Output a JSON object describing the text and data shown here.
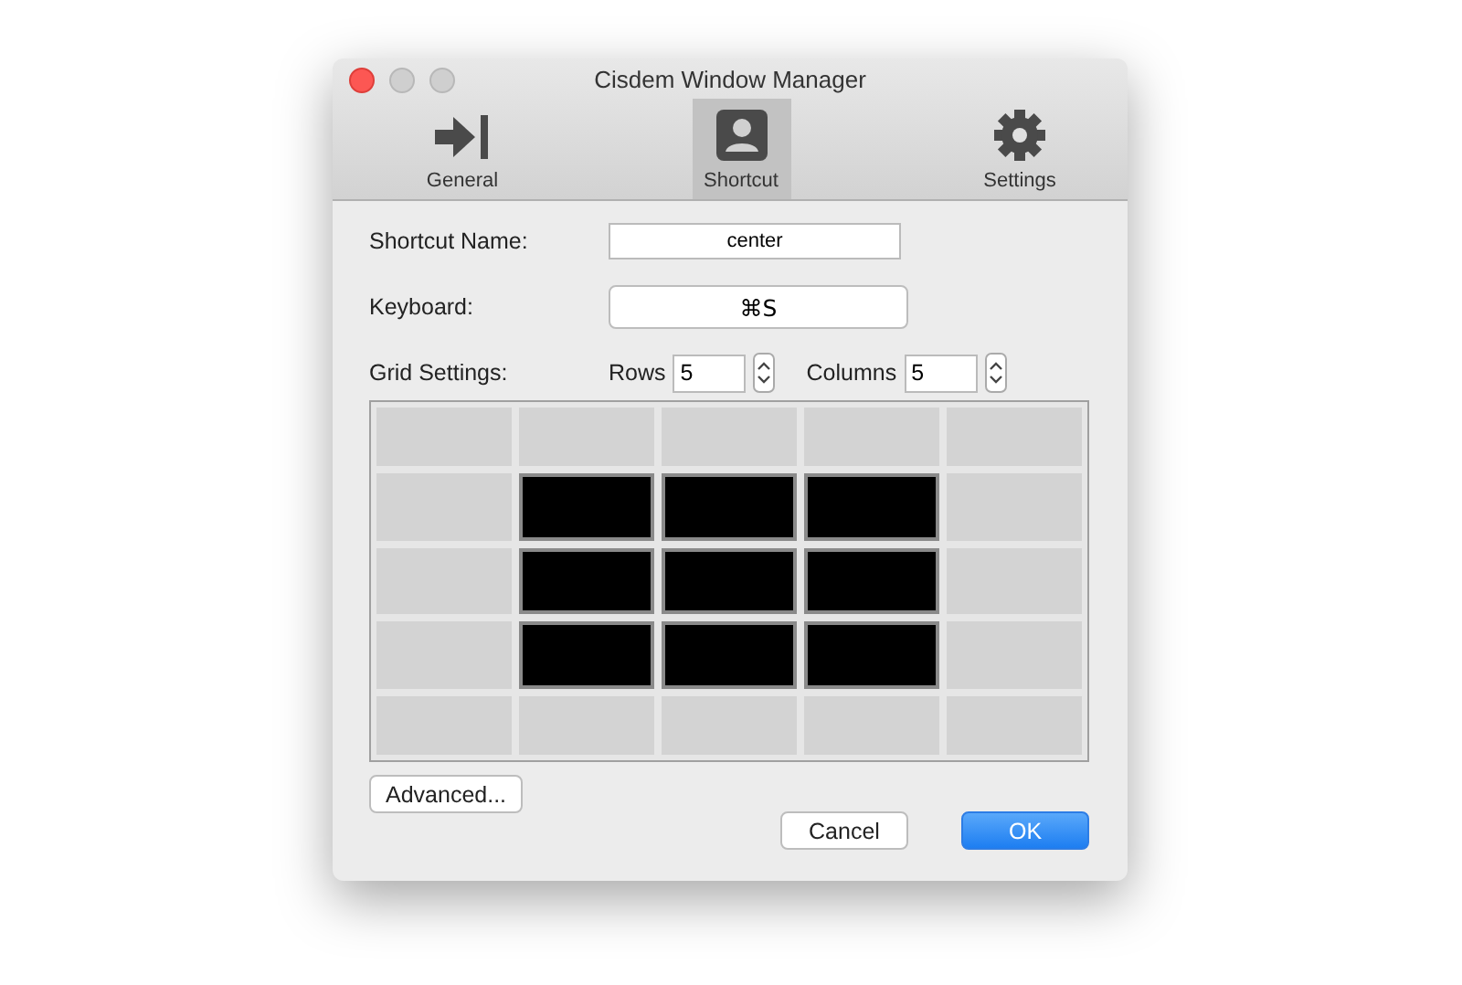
{
  "window": {
    "title": "Cisdem Window Manager"
  },
  "tabs": [
    {
      "label": "General",
      "kind": "general",
      "selected": false
    },
    {
      "label": "Shortcut",
      "kind": "shortcut",
      "selected": true
    },
    {
      "label": "Settings",
      "kind": "settings",
      "selected": false
    }
  ],
  "shortcut_name": {
    "label": "Shortcut Name:",
    "value": "center"
  },
  "keyboard": {
    "label": "Keyboard:",
    "value": "⌘S"
  },
  "grid_settings": {
    "label": "Grid Settings:",
    "rows_label": "Rows",
    "rows": "5",
    "columns_label": "Columns",
    "columns": "5"
  },
  "grid": [
    [
      {
        "selected": false
      },
      {
        "selected": false
      },
      {
        "selected": false
      },
      {
        "selected": false
      },
      {
        "selected": false
      }
    ],
    [
      {
        "selected": false
      },
      {
        "selected": true
      },
      {
        "selected": true
      },
      {
        "selected": true
      },
      {
        "selected": false
      }
    ],
    [
      {
        "selected": false
      },
      {
        "selected": true
      },
      {
        "selected": true
      },
      {
        "selected": true
      },
      {
        "selected": false
      }
    ],
    [
      {
        "selected": false
      },
      {
        "selected": true
      },
      {
        "selected": true
      },
      {
        "selected": true
      },
      {
        "selected": false
      }
    ],
    [
      {
        "selected": false
      },
      {
        "selected": false
      },
      {
        "selected": false
      },
      {
        "selected": false
      },
      {
        "selected": false
      }
    ]
  ],
  "buttons": {
    "advanced": "Advanced...",
    "cancel": "Cancel",
    "ok": "OK"
  }
}
